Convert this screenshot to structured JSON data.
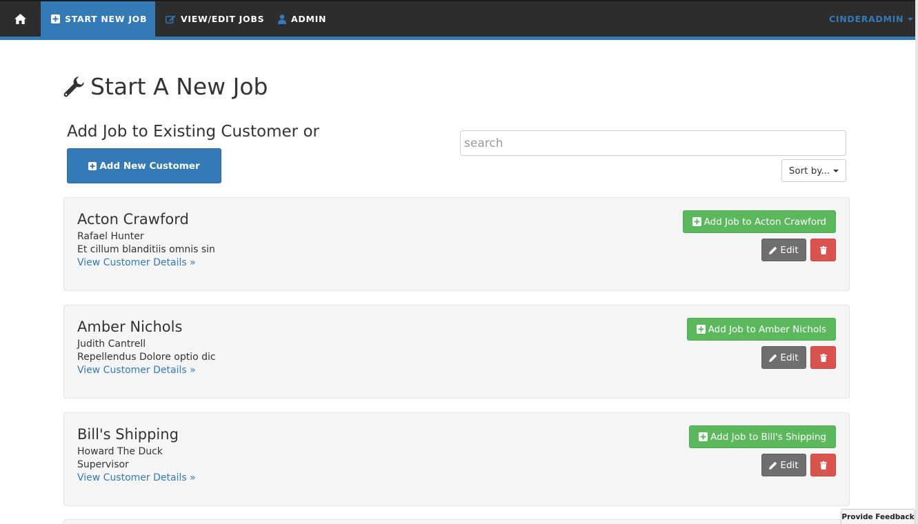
{
  "navbar": {
    "home_icon": "home-icon",
    "start_new_job": "START NEW JOB",
    "view_edit_jobs": "VIEW/EDIT JOBS",
    "admin": "ADMIN",
    "user": "CINDERADMIN",
    "active_color": "#337ab7",
    "bg_color": "#2d2d2d"
  },
  "page": {
    "title": "Start A New Job",
    "title_icon": "wrench-icon",
    "subheading": "Add Job to Existing Customer or",
    "add_customer_label": "Add New Customer"
  },
  "search": {
    "placeholder": "search",
    "value": ""
  },
  "sort": {
    "label": "Sort by..."
  },
  "customers": [
    {
      "name": "Acton Crawford",
      "contact": "Rafael Hunter",
      "detail": "Et cillum blanditiis omnis sin",
      "link": "View Customer Details »",
      "add_job_label": "Add Job to Acton Crawford",
      "edit_label": "Edit"
    },
    {
      "name": "Amber Nichols",
      "contact": "Judith Cantrell",
      "detail": "Repellendus Dolore optio dic",
      "link": "View Customer Details »",
      "add_job_label": "Add Job to Amber Nichols",
      "edit_label": "Edit"
    },
    {
      "name": "Bill's Shipping",
      "contact": "Howard The Duck",
      "detail": "Supervisor",
      "link": "View Customer Details »",
      "add_job_label": "Add Job to Bill's Shipping",
      "edit_label": "Edit"
    }
  ],
  "colors": {
    "success": "#5cb85c",
    "danger": "#d9534f",
    "edit": "#6f6f6f",
    "primary": "#337ab7"
  },
  "feedback": {
    "label": "Provide Feedback"
  }
}
